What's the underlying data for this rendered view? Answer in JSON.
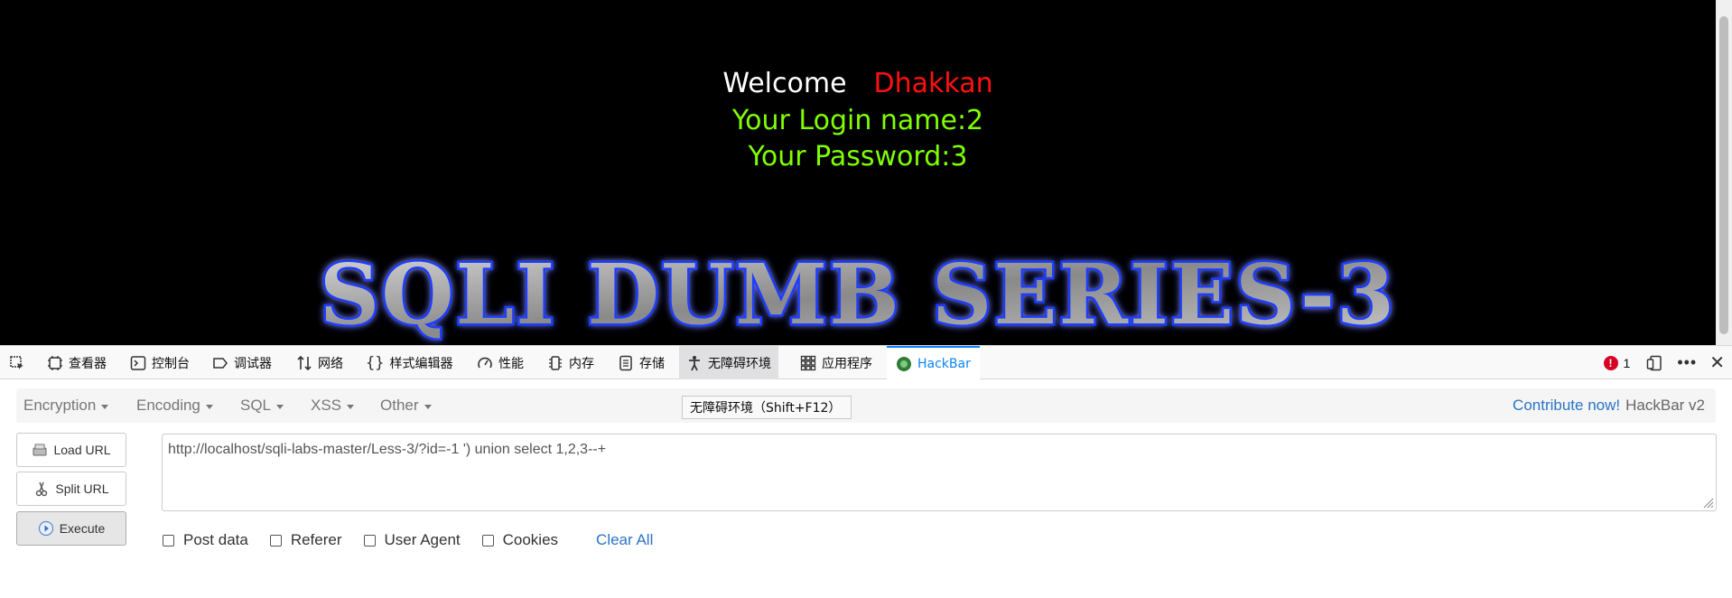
{
  "page": {
    "welcome_label": "Welcome",
    "username": "Dhakkan",
    "login_line": "Your Login name:2",
    "password_line": "Your Password:3",
    "banner_text": "SQLI DUMB SERIES-3",
    "colors": {
      "background": "#000000",
      "welcome": "#ffffff",
      "username": "#ff1010",
      "result": "#7fff00",
      "banner_glow": "#1a3cff"
    }
  },
  "devtools": {
    "tabs": [
      {
        "name": "inspector",
        "label": "查看器",
        "icon": "inspector-icon"
      },
      {
        "name": "console",
        "label": "控制台",
        "icon": "console-icon"
      },
      {
        "name": "debugger",
        "label": "调试器",
        "icon": "debugger-icon"
      },
      {
        "name": "network",
        "label": "网络",
        "icon": "network-icon"
      },
      {
        "name": "style-editor",
        "label": "样式编辑器",
        "icon": "braces-icon"
      },
      {
        "name": "performance",
        "label": "性能",
        "icon": "gauge-icon"
      },
      {
        "name": "memory",
        "label": "内存",
        "icon": "memory-icon"
      },
      {
        "name": "storage",
        "label": "存储",
        "icon": "storage-icon"
      },
      {
        "name": "accessibility",
        "label": "无障碍环境",
        "icon": "accessibility-icon"
      },
      {
        "name": "application",
        "label": "应用程序",
        "icon": "grid-icon"
      },
      {
        "name": "hackbar",
        "label": "HackBar",
        "icon": "hackbar-icon"
      }
    ],
    "error_count": "1",
    "tooltip": "无障碍环境（Shift+F12）"
  },
  "hackbar": {
    "menu": [
      "Encryption",
      "Encoding",
      "SQL",
      "XSS",
      "Other"
    ],
    "contribute_link": "Contribute now!",
    "version": "HackBar v2",
    "buttons": {
      "load": "Load URL",
      "split": "Split URL",
      "execute": "Execute"
    },
    "url": "http://localhost/sqli-labs-master/Less-3/?id=-1 ') union select 1,2,3--+",
    "options": [
      "Post data",
      "Referer",
      "User Agent",
      "Cookies"
    ],
    "clear_all": "Clear All"
  }
}
